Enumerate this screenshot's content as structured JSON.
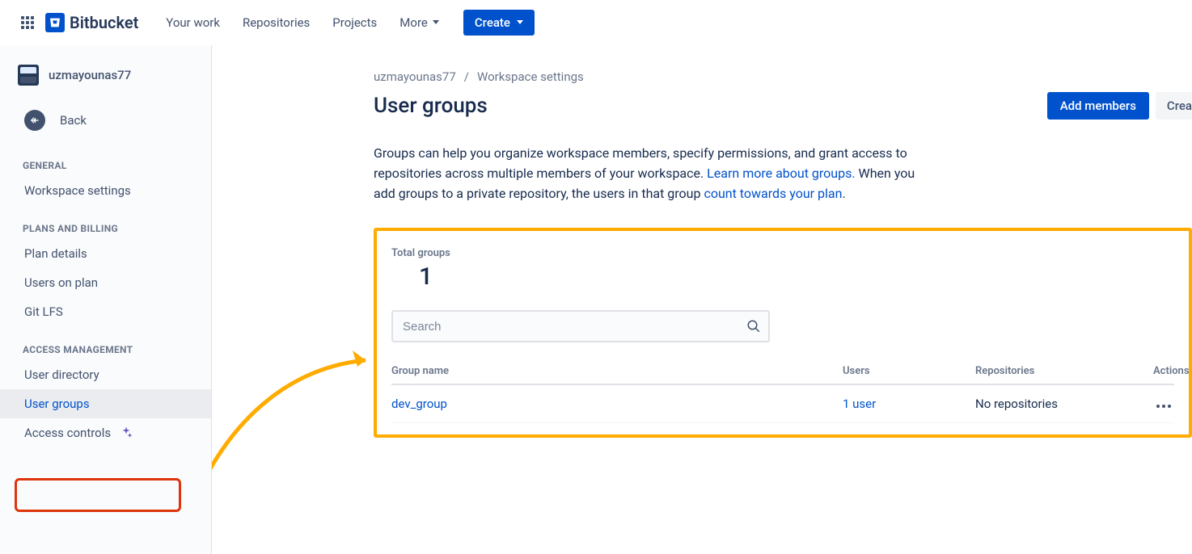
{
  "topbar": {
    "brand": "Bitbucket",
    "nav": [
      "Your work",
      "Repositories",
      "Projects",
      "More"
    ],
    "create_label": "Create"
  },
  "sidebar": {
    "workspace_name": "uzmayounas77",
    "back_label": "Back",
    "sections": {
      "general": {
        "title": "GENERAL",
        "items": [
          "Workspace settings"
        ]
      },
      "plans": {
        "title": "PLANS AND BILLING",
        "items": [
          "Plan details",
          "Users on plan",
          "Git LFS"
        ]
      },
      "access": {
        "title": "ACCESS MANAGEMENT",
        "items": [
          "User directory",
          "User groups",
          "Access controls"
        ]
      }
    }
  },
  "breadcrumb": {
    "workspace": "uzmayounas77",
    "current": "Workspace settings"
  },
  "page": {
    "title": "User groups",
    "add_members_label": "Add members",
    "create_cut_label": "Crea",
    "desc_part1": "Groups can help you organize workspace members, specify permissions, and grant access to repositories across multiple members of your workspace. ",
    "desc_link1": "Learn more about groups.",
    "desc_part2": " When you add groups to a private repository, the users in that group ",
    "desc_link2": "count towards your plan",
    "desc_part3": "."
  },
  "groups": {
    "total_label": "Total groups",
    "total_count": "1",
    "search_placeholder": "Search",
    "columns": {
      "name": "Group name",
      "users": "Users",
      "repos": "Repositories",
      "actions": "Actions"
    },
    "rows": [
      {
        "name": "dev_group",
        "users": "1 user",
        "repos": "No repositories"
      }
    ]
  }
}
